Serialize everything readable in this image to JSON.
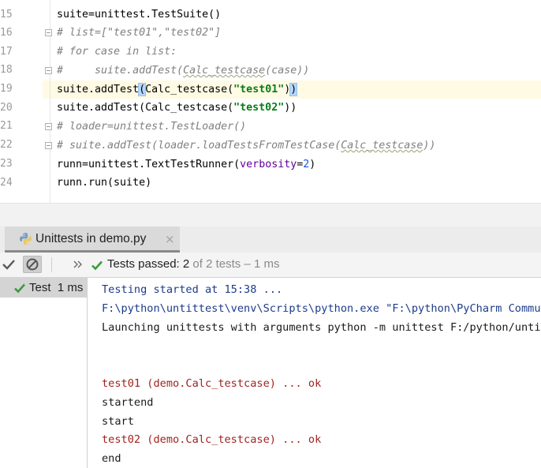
{
  "editor": {
    "line_numbers": [
      "15",
      "16",
      "17",
      "18",
      "19",
      "20",
      "21",
      "22",
      "23",
      "24"
    ],
    "lines": {
      "l15": "suite=unittest.TestSuite()",
      "l16": "# list=[\"test01\",\"test02\"]",
      "l17": "# for case in list:",
      "l18a": "#     suite.addTest(",
      "l18b": "Calc_testcase",
      "l18c": "(case))",
      "l19a": "suite.addTest",
      "l19b": "(",
      "l19c": "Calc_testcase(",
      "l19d": "\"test01\"",
      "l19e": ")",
      "l19f": ")",
      "l20a": "suite.addTest(Calc_testcase(",
      "l20b": "\"test02\"",
      "l20c": "))",
      "l21": "# loader=unittest.TestLoader()",
      "l22a": "# suite.addTest(loader.loadTestsFromTestCase(",
      "l22b": "Calc_testcase",
      "l22c": "))",
      "l23a": "runn=unittest.TextTestRunner(",
      "l23b": "verbosity",
      "l23c": "=",
      "l23d": "2",
      "l23e": ")",
      "l24": "runn.run(suite)"
    }
  },
  "run_panel": {
    "tab_label": "Unittests in demo.py",
    "tab_close": "×",
    "status": {
      "prefix": "Tests passed: ",
      "passed": "2",
      "suffix": " of 2 tests – 1 ms"
    },
    "tree": {
      "item_label": "Test",
      "item_time": "1 ms"
    },
    "console": [
      "Testing started at 15:38 ...",
      "F:\\python\\untittest\\venv\\Scripts\\python.exe \"F:\\python\\PyCharm Communi",
      "Launching unittests with arguments python -m unittest F:/python/untitt",
      "test01 (demo.Calc_testcase) ... ok",
      "startend",
      "start",
      "test02 (demo.Calc_testcase) ... ok",
      "end"
    ]
  },
  "colors": {
    "pass_green": "#3a9b3a",
    "console_system": "#1d3b8a",
    "console_stderr": "#a0231f",
    "current_line": "#fffae3"
  },
  "icons": [
    "fold-marker-icon",
    "python-file-icon",
    "close-icon",
    "check-icon",
    "stop-icon",
    "chevron-double-right-icon",
    "pass-check-icon"
  ]
}
